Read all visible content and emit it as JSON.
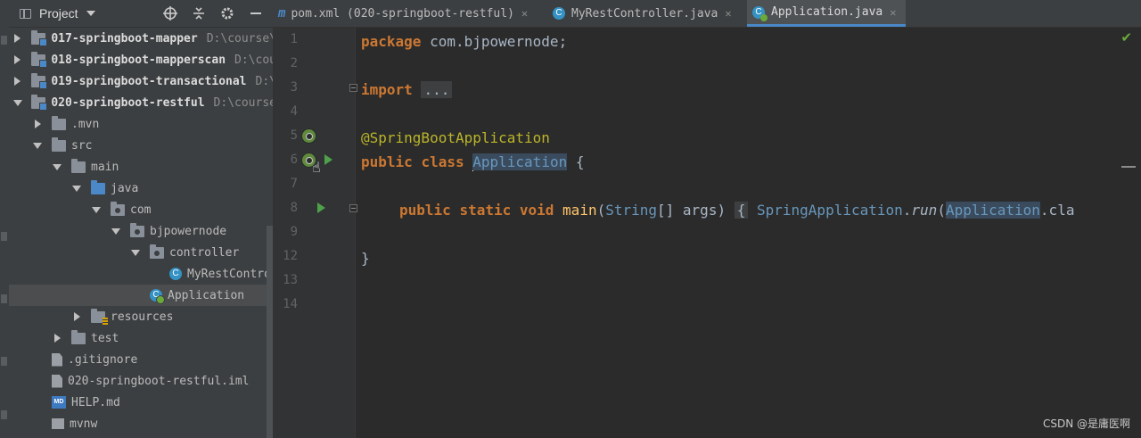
{
  "project_panel": {
    "title": "Project",
    "tools": [
      "target-icon",
      "collapse-icon",
      "gear-icon",
      "minimize-icon"
    ],
    "tree": [
      {
        "label": "017-springboot-mapper",
        "path": "D:\\course\\",
        "bold": true
      },
      {
        "label": "018-springboot-mapperscan",
        "path": "D:\\cou",
        "bold": true
      },
      {
        "label": "019-springboot-transactional",
        "path": "D:\\",
        "bold": true
      },
      {
        "label": "020-springboot-restful",
        "path": "D:\\course",
        "bold": true
      },
      {
        "label": ".mvn"
      },
      {
        "label": "src"
      },
      {
        "label": "main"
      },
      {
        "label": "java"
      },
      {
        "label": "com"
      },
      {
        "label": "bjpowernode"
      },
      {
        "label": "controller"
      },
      {
        "label": "MyRestContro"
      },
      {
        "label": "Application"
      },
      {
        "label": "resources"
      },
      {
        "label": "test"
      },
      {
        "label": ".gitignore"
      },
      {
        "label": "020-springboot-restful.iml"
      },
      {
        "label": "HELP.md"
      },
      {
        "label": "mvnw"
      }
    ]
  },
  "tabs": [
    {
      "label": "pom.xml (020-springboot-restful)",
      "icon": "m"
    },
    {
      "label": "MyRestController.java",
      "icon": "C"
    },
    {
      "label": "Application.java",
      "icon": "C"
    }
  ],
  "editor": {
    "line_numbers": [
      "1",
      "2",
      "3",
      "4",
      "5",
      "6",
      "7",
      "8",
      "9",
      "12",
      "13",
      "14"
    ],
    "code": {
      "l1_kw": "package",
      "l1_rest": " com.bjpowernode;",
      "l3_kw": "import",
      "l3_dots": "...",
      "l6_ann": "@SpringBootApplication",
      "l7_kw1": "public",
      "l7_kw2": "class",
      "l7_cls": "Application",
      "l7_rest": " {",
      "l9_kw1": "public",
      "l9_kw2": "static",
      "l9_kw3": "void",
      "l9_fn": "main",
      "l9_args_a": "(",
      "l9_type": "String",
      "l9_args_b": "[] args)",
      "l9_brace": "{",
      "l9_call_cls": "SpringApplication",
      "l9_dot": ".",
      "l9_call_fn": "run",
      "l9_paren": "(",
      "l9_arg_cls": "Application",
      "l9_tail": ".cla",
      "l13_close": "}"
    }
  },
  "watermark": "CSDN @是庸医啊"
}
